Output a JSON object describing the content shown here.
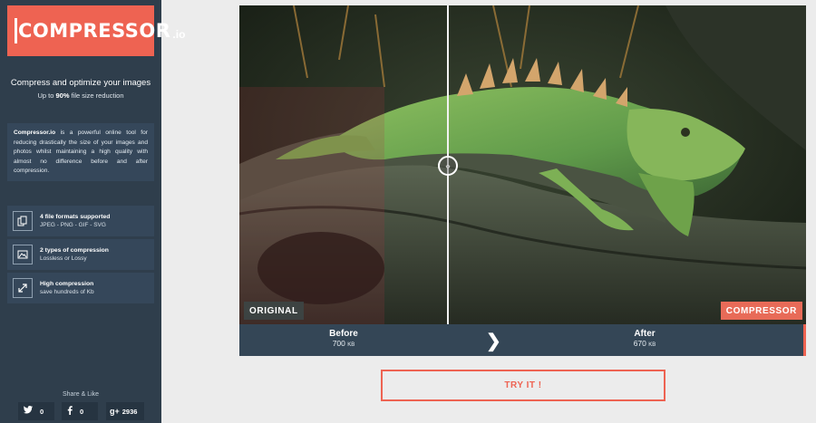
{
  "brand": {
    "logo_name": "COMPRESSOR",
    "logo_suffix": ".io"
  },
  "tagline": {
    "title": "Compress and optimize your images",
    "sub_prefix": "Up to ",
    "sub_highlight": "90%",
    "sub_suffix": " file size reduction"
  },
  "description": {
    "lead": "Compressor.io",
    "text": " is a powerful online tool for reducing drastically the size of your images and photos whilst maintaining a high quality with almost no difference before and after compression."
  },
  "features": [
    {
      "icon": "file-formats-icon",
      "title": "4 file formats supported",
      "subtitle": "JPEG - PNG - GIF - SVG"
    },
    {
      "icon": "image-icon",
      "title": "2 types of compression",
      "subtitle": "Lossless or Lossy"
    },
    {
      "icon": "compress-arrows-icon",
      "title": "High compression",
      "subtitle": "save hundreds of Kb"
    }
  ],
  "share": {
    "label": "Share & Like",
    "twitter_count": "0",
    "facebook_count": "0",
    "gplus_count": "2936"
  },
  "comparison": {
    "original_badge": "ORIGINAL",
    "compressed_badge": "COMPRESSOR",
    "before_label": "Before",
    "before_size": "700",
    "before_unit": "KB",
    "after_label": "After",
    "after_size": "670",
    "after_unit": "KB"
  },
  "actions": {
    "try_label": "TRY IT !"
  },
  "colors": {
    "accent": "#ee6352",
    "sidebar": "#2f3e4c",
    "panel": "#35475a"
  }
}
